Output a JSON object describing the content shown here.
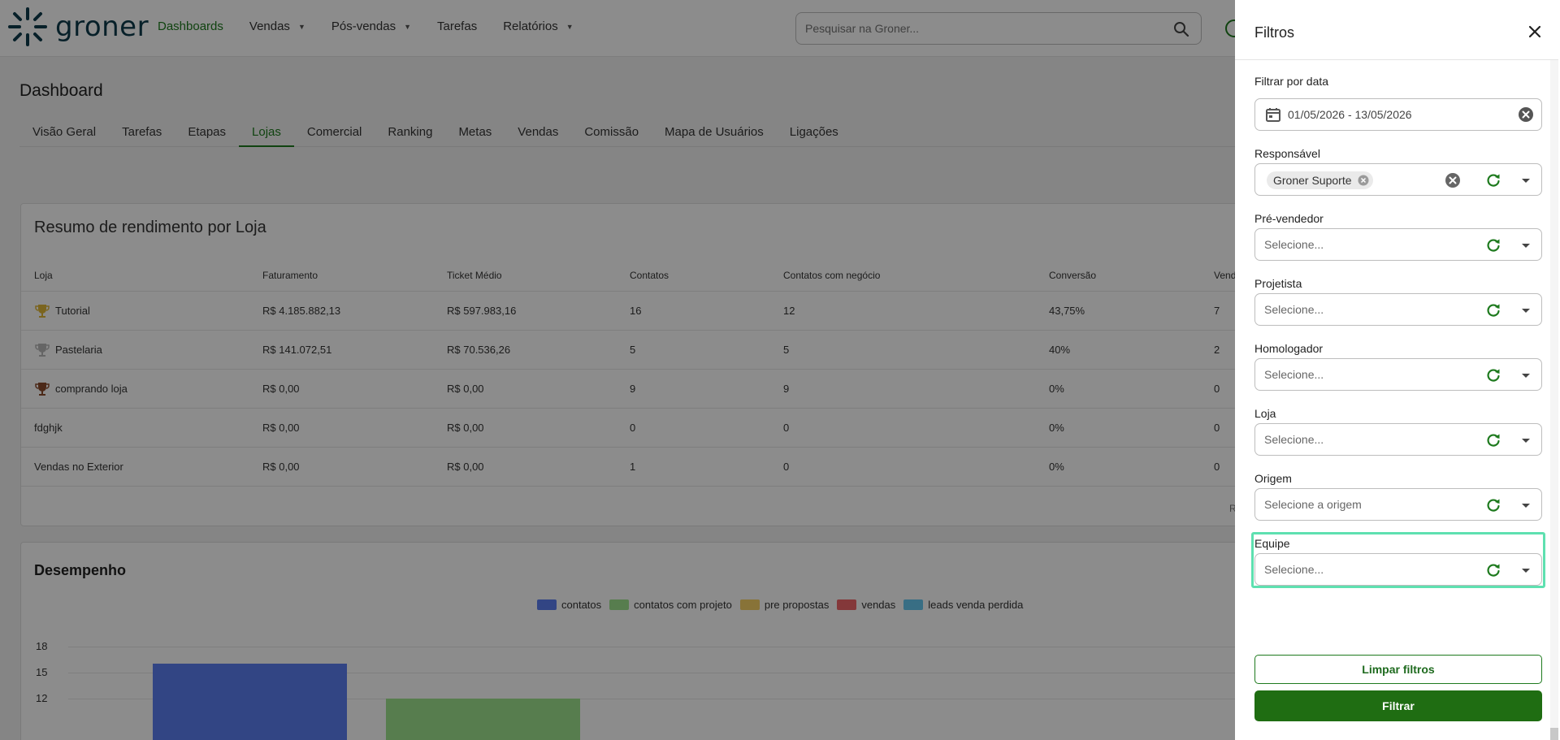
{
  "brand": {
    "name": "groner"
  },
  "nav": [
    {
      "label": "Dashboards",
      "has_menu": false
    },
    {
      "label": "Vendas",
      "has_menu": true
    },
    {
      "label": "Pós-vendas",
      "has_menu": true
    },
    {
      "label": "Tarefas",
      "has_menu": false
    },
    {
      "label": "Relatórios",
      "has_menu": true
    }
  ],
  "search": {
    "placeholder": "Pesquisar na Groner..."
  },
  "page": {
    "title": "Dashboard"
  },
  "tabs": [
    "Visão Geral",
    "Tarefas",
    "Etapas",
    "Lojas",
    "Comercial",
    "Ranking",
    "Metas",
    "Vendas",
    "Comissão",
    "Mapa de Usuários",
    "Ligações"
  ],
  "active_tab": "Lojas",
  "summary": {
    "title": "Resumo de rendimento por Loja",
    "columns": [
      "Loja",
      "Faturamento",
      "Ticket Médio",
      "Contatos",
      "Contatos com negócio",
      "Conversão",
      "Vend"
    ],
    "rows": [
      {
        "loja": "Tutorial",
        "trophy": "gold",
        "faturamento": "R$ 4.185.882,13",
        "ticket": "R$ 597.983,16",
        "contatos": "16",
        "negocio": "12",
        "conversao": "43,75%",
        "vendas": "7"
      },
      {
        "loja": "Pastelaria",
        "trophy": "silver",
        "faturamento": "R$ 141.072,51",
        "ticket": "R$ 70.536,26",
        "contatos": "5",
        "negocio": "5",
        "conversao": "40%",
        "vendas": "2"
      },
      {
        "loja": "comprando loja",
        "trophy": "bronze",
        "faturamento": "R$ 0,00",
        "ticket": "R$ 0,00",
        "contatos": "9",
        "negocio": "9",
        "conversao": "0%",
        "vendas": "0"
      },
      {
        "loja": "fdghjk",
        "trophy": "",
        "faturamento": "R$ 0,00",
        "ticket": "R$ 0,00",
        "contatos": "0",
        "negocio": "0",
        "conversao": "0%",
        "vendas": "0"
      },
      {
        "loja": "Vendas no Exterior",
        "trophy": "",
        "faturamento": "R$ 0,00",
        "ticket": "R$ 0,00",
        "contatos": "1",
        "negocio": "0",
        "conversao": "0%",
        "vendas": "0"
      }
    ],
    "footer_fragment": "R"
  },
  "chart_data": {
    "type": "bar",
    "title": "Desempenho",
    "legend": [
      "contatos",
      "contatos com projeto",
      "pre propostas",
      "vendas",
      "leads venda perdida"
    ],
    "legend_colors": [
      "#5b7ff0",
      "#9ee38f",
      "#f7d167",
      "#f0666b",
      "#66c8f0"
    ],
    "y_ticks": [
      "18",
      "15",
      "12"
    ],
    "ylim": [
      0,
      18
    ],
    "series": [
      {
        "name": "contatos",
        "values": [
          16
        ]
      },
      {
        "name": "contatos com projeto",
        "values": [
          12
        ]
      }
    ]
  },
  "filters": {
    "title": "Filtros",
    "date": {
      "label": "Filtrar por data",
      "value": "01/05/2026 - 13/05/2026"
    },
    "responsavel": {
      "label": "Responsável",
      "chip": "Groner Suporte"
    },
    "pre_vendedor": {
      "label": "Pré-vendedor",
      "placeholder": "Selecione..."
    },
    "projetista": {
      "label": "Projetista",
      "placeholder": "Selecione..."
    },
    "homologador": {
      "label": "Homologador",
      "placeholder": "Selecione..."
    },
    "loja": {
      "label": "Loja",
      "placeholder": "Selecione..."
    },
    "origem": {
      "label": "Origem",
      "placeholder": "Selecione a origem"
    },
    "equipe": {
      "label": "Equipe",
      "placeholder": "Selecione..."
    },
    "clear_label": "Limpar filtros",
    "submit_label": "Filtrar"
  },
  "colors": {
    "brand_green": "#1f6d12",
    "accent_green": "#1e7a1e",
    "focus": "#5ee0b0"
  }
}
